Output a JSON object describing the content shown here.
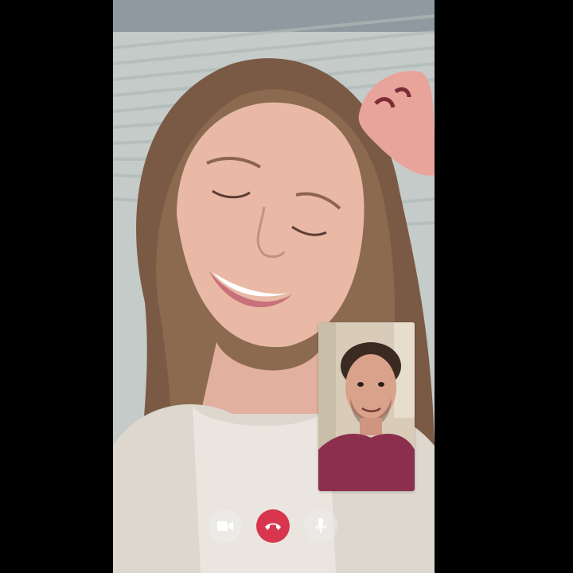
{
  "call": {
    "remote_feed_icon": "remote-participant-video",
    "self_view_icon": "self-camera-preview"
  },
  "controls": [
    {
      "icon": "video-camera-icon",
      "color": "#ffffff"
    },
    {
      "icon": "end-call-icon",
      "color": "#d8364e"
    },
    {
      "icon": "microphone-icon",
      "color": "#ffffff"
    }
  ]
}
